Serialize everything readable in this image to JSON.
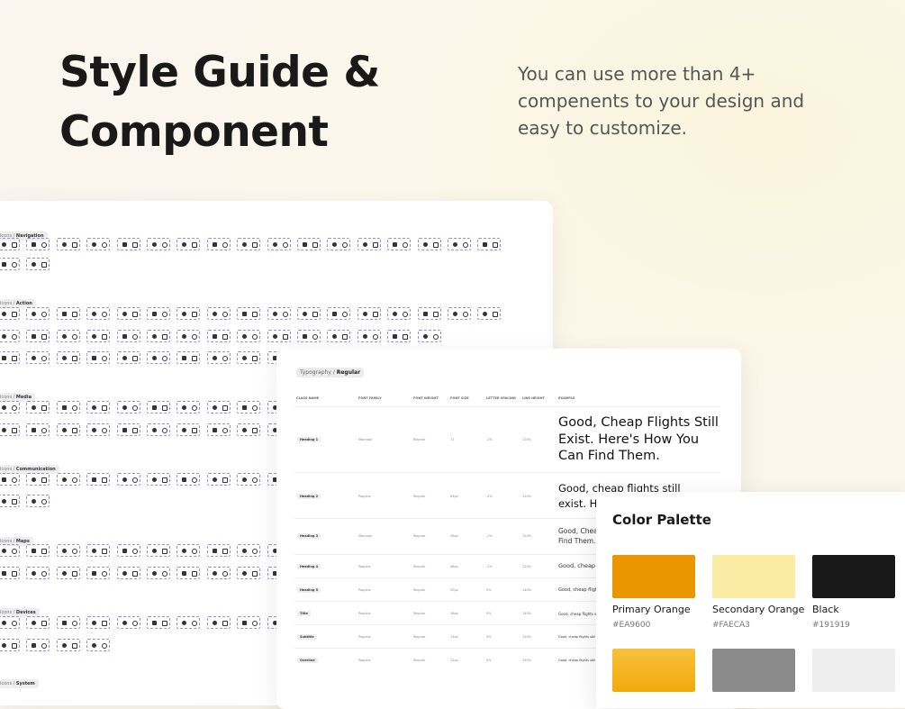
{
  "hero": {
    "title_line1": "Style Guide &",
    "title_line2": "Component",
    "subtitle": "You can use more than 4+ compenents to your design and easy to customize."
  },
  "icons_panel": {
    "sections": [
      {
        "prefix": "Icons / ",
        "name": "Navigation"
      },
      {
        "prefix": "Icons / ",
        "name": "Action"
      },
      {
        "prefix": "Icons / ",
        "name": "Media"
      },
      {
        "prefix": "Icons / ",
        "name": "Communication"
      },
      {
        "prefix": "Icons / ",
        "name": "Maps"
      },
      {
        "prefix": "Icons / ",
        "name": "Devices"
      },
      {
        "prefix": "Icons / ",
        "name": "System"
      }
    ]
  },
  "typography": {
    "chip_prefix": "Typography / ",
    "chip_name": "Regular",
    "headers": [
      "CLASS NAME",
      "FONT FAMILY",
      "FONT WEIGHT",
      "FONT SIZE",
      "LETTER SPACING",
      "LINE HEIGHT",
      "EXAMPLE"
    ],
    "rows": [
      {
        "class": "Heading 1",
        "family": "Manrope",
        "weight": "Regular",
        "size": "72",
        "spacing": "-2%",
        "line": "120%",
        "example": "Good, Cheap Flights Still Exist. Here's How You Can Find Them."
      },
      {
        "class": "Heading 2",
        "family": "Poppins",
        "weight": "Regular",
        "size": "64px",
        "spacing": "-2%",
        "line": "120%",
        "example": "Good, cheap flights still exist. Here's h"
      },
      {
        "class": "Heading 3",
        "family": "Manrope",
        "weight": "Regular",
        "size": "56px",
        "spacing": "-2%",
        "line": "120%",
        "example": "Good, Cheap Find Them."
      },
      {
        "class": "Heading 4",
        "family": "Poppins",
        "weight": "Regular",
        "size": "48px",
        "spacing": "-2%",
        "line": "120%",
        "example": "Good, cheap fli"
      },
      {
        "class": "Heading 5",
        "family": "Poppins",
        "weight": "Regular",
        "size": "32px",
        "spacing": "0%",
        "line": "140%",
        "example": "Good, cheap flights"
      },
      {
        "class": "Title",
        "family": "Poppins",
        "weight": "Regular",
        "size": "16px",
        "spacing": "0%",
        "line": "140%",
        "example": "Good, cheap flights still"
      },
      {
        "class": "Subtitle",
        "family": "Poppins",
        "weight": "Regular",
        "size": "14px",
        "spacing": "0%",
        "line": "150%",
        "example": "Good, cheap flights still exi"
      },
      {
        "class": "Overline",
        "family": "Poppins",
        "weight": "Regular",
        "size": "12px",
        "spacing": "0%",
        "line": "150%",
        "example": "Good, cheap flights still exist. H"
      }
    ]
  },
  "palette": {
    "title": "Color Palette",
    "colors": [
      {
        "name": "Primary Orange",
        "hex_label": "#EA9600",
        "hex": "#EA9600"
      },
      {
        "name": "Secondary Orange",
        "hex_label": "#FAECA3",
        "hex": "#FAECA3"
      },
      {
        "name": "Black",
        "hex_label": "#191919",
        "hex": "#191919"
      },
      {
        "name": "",
        "hex_label": "",
        "hex": "#F8C13B"
      },
      {
        "name": "",
        "hex_label": "",
        "hex": "#8A8A8A"
      },
      {
        "name": "",
        "hex_label": "",
        "hex": "#EDEDED"
      }
    ]
  }
}
